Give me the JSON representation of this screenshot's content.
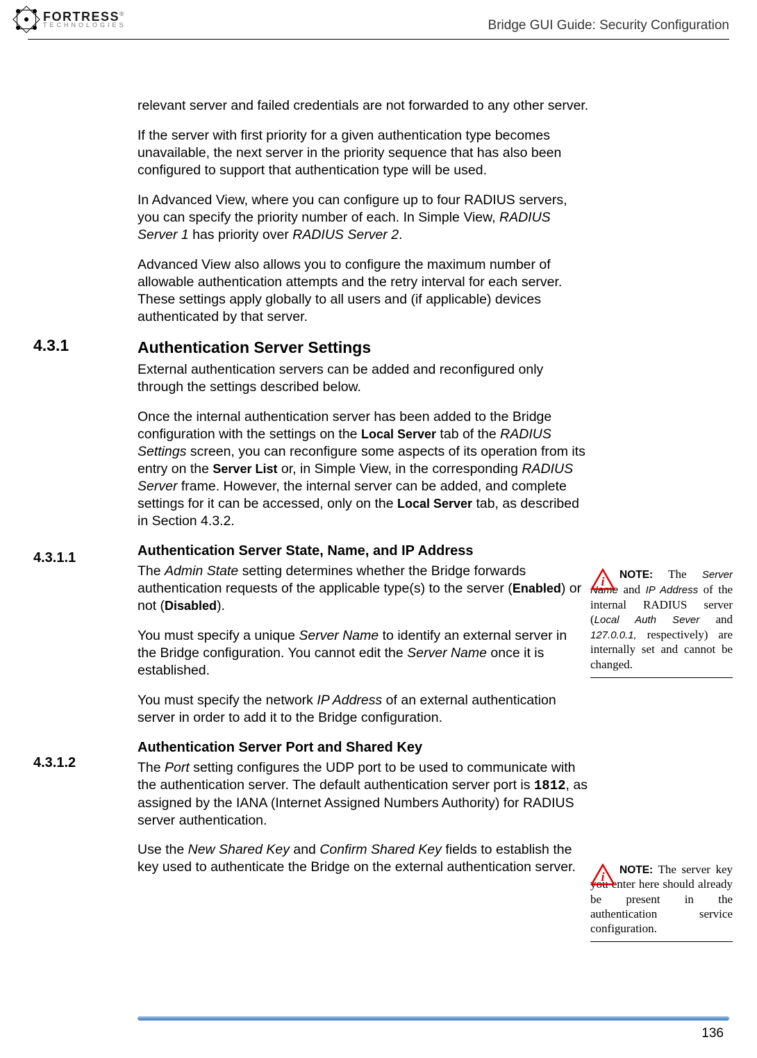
{
  "header": {
    "logo_line1": "FORTRESS",
    "logo_trademark": "®",
    "logo_line2": "TECHNOLOGIES",
    "doc_title": "Bridge GUI Guide: Security Configuration"
  },
  "sections": {
    "s431_num": "4.3.1",
    "s431_title": "Authentication Server Settings",
    "s4311_num": "4.3.1.1",
    "s4311_title": "Authentication Server State, Name, and IP Address",
    "s4312_num": "4.3.1.2",
    "s4312_title": "Authentication Server Port and Shared Key"
  },
  "para": {
    "p1": "relevant server and failed credentials are not forwarded to any other server.",
    "p2": "If the server with first priority for a given authentication type becomes unavailable, the next server in the priority sequence that has also been configured to support that authentication type will be used.",
    "p3a": "In Advanced View, where you can configure up to four RADIUS servers, you can specify the priority number of each. In Simple View, ",
    "p3b": "RADIUS Server 1",
    "p3c": " has priority over ",
    "p3d": "RADIUS Server 2",
    "p3e": ".",
    "p4": "Advanced View also allows you to configure the maximum number of allowable authentication attempts and the retry interval for each server. These settings apply globally to all users and (if applicable) devices authenticated by that server.",
    "p5": "External authentication servers can be added and reconfigured only through the settings described below.",
    "p6a": "Once the internal authentication server has been added to the Bridge configuration with the settings on the ",
    "p6b": "Local Server",
    "p6c": " tab of the ",
    "p6d": "RADIUS Settings",
    "p6e": " screen, you can reconfigure some aspects of its operation from its entry on the ",
    "p6f": "Server List",
    "p6g": " or, in Simple View, in the corresponding ",
    "p6h": "RADIUS Server",
    "p6i": " frame. However, the internal server can be added, and complete settings for it can be accessed, only on the ",
    "p6j": "Local Server",
    "p6k": " tab, as described in Section 4.3.2.",
    "p7a": "The ",
    "p7b": "Admin State",
    "p7c": " setting determines whether the Bridge forwards authentication requests of the applicable type(s) to the server (",
    "p7d": "Enabled",
    "p7e": ") or not (",
    "p7f": "Disabled",
    "p7g": ").",
    "p8a": "You must specify a unique ",
    "p8b": "Server Name",
    "p8c": " to identify an external server in the Bridge configuration. You cannot edit the ",
    "p8d": "Server Name",
    "p8e": " once it is established.",
    "p9a": "You must specify the network ",
    "p9b": "IP Address",
    "p9c": " of an external authentication server in order to add it to the Bridge configuration.",
    "p10a": "The ",
    "p10b": "Port",
    "p10c": " setting configures the UDP port to be used to communicate with the authentication server. The default authentication server port is ",
    "p10d": "1812",
    "p10e": ", as assigned by the IANA (Internet Assigned Numbers Authority) for RADIUS server authentication.",
    "p11a": "Use the ",
    "p11b": "New Shared Key",
    "p11c": " and ",
    "p11d": "Confirm Shared Key",
    "p11e": " fields to establish the key used to authenticate the Bridge on the external authentication server."
  },
  "notes": {
    "n1_label": "NOTE:",
    "n1_a": " The ",
    "n1_b": "Server Name",
    "n1_c": " and ",
    "n1_d": "IP Ad­dress",
    "n1_e": " of the internal RA­DIUS server (",
    "n1_f": "Local Auth Sever",
    "n1_g": " and ",
    "n1_h": "127.0.0.1,",
    "n1_i": " re­spectively) are internal­ly set and cannot be changed.",
    "n2_label": "NOTE:",
    "n2_a": " The server key you enter here should already be pres­ent in the authentication service configuration."
  },
  "footer": {
    "page_number": "136"
  }
}
